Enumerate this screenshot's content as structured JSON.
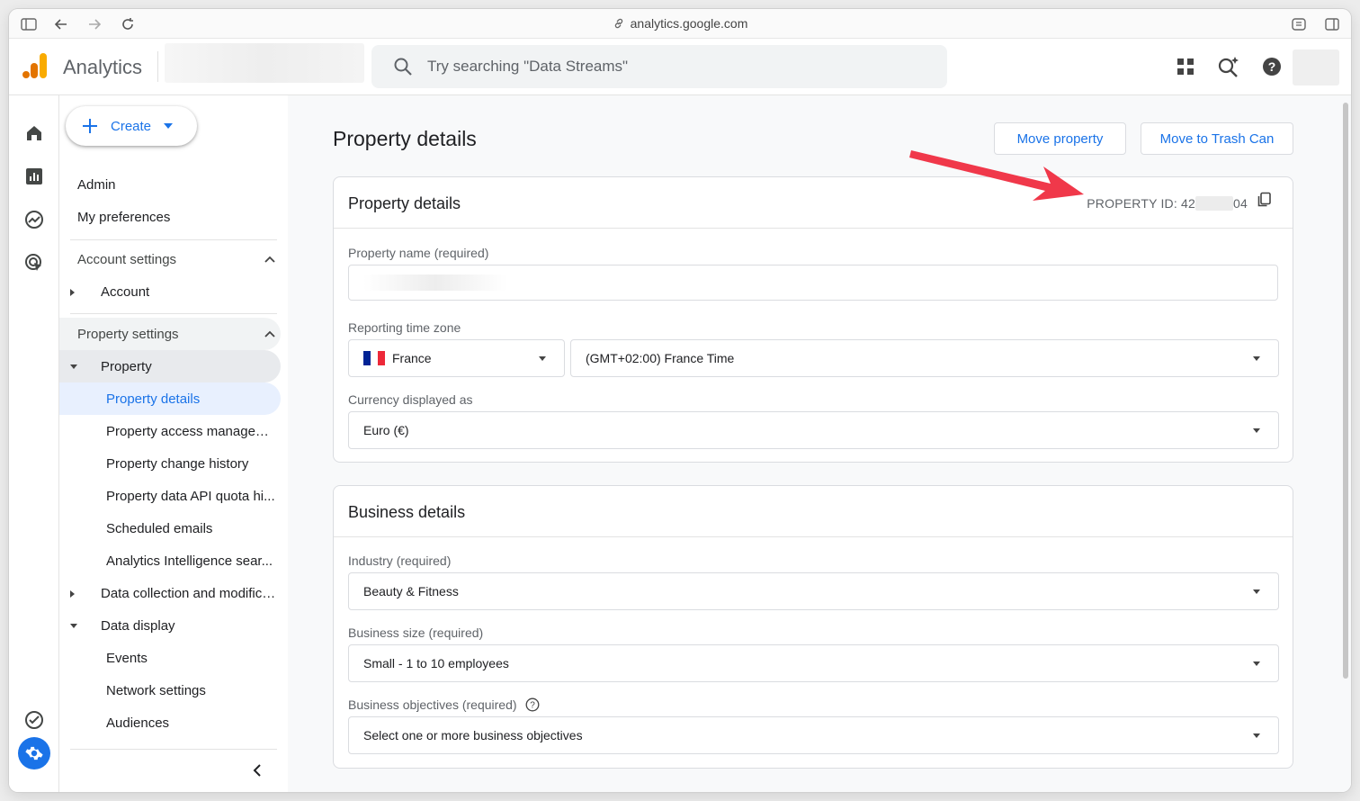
{
  "browser": {
    "url": "analytics.google.com"
  },
  "header": {
    "app_title": "Analytics",
    "search_placeholder": "Try searching \"Data Streams\""
  },
  "sidebar": {
    "create_label": "Create",
    "admin": "Admin",
    "my_preferences": "My preferences",
    "account_settings": "Account settings",
    "account": "Account",
    "property_settings": "Property settings",
    "property": "Property",
    "property_items": [
      "Property details",
      "Property access managem...",
      "Property change history",
      "Property data API quota hi...",
      "Scheduled emails",
      "Analytics Intelligence sear..."
    ],
    "data_collection": "Data collection and modifica...",
    "data_display": "Data display",
    "data_display_items": [
      "Events",
      "Network settings",
      "Audiences"
    ]
  },
  "main": {
    "page_title": "Property details",
    "move_property": "Move property",
    "move_to_trash": "Move to Trash Can",
    "property_card": {
      "title": "Property details",
      "property_id_prefix": "PROPERTY ID: 42",
      "property_id_suffix": "04",
      "property_name_label": "Property name (required)",
      "time_zone_label": "Reporting time zone",
      "country": "France",
      "time_zone": "(GMT+02:00) France Time",
      "currency_label": "Currency displayed as",
      "currency": "Euro (€)"
    },
    "business_card": {
      "title": "Business details",
      "industry_label": "Industry (required)",
      "industry": "Beauty & Fitness",
      "size_label": "Business size (required)",
      "size": "Small - 1 to 10 employees",
      "objectives_label": "Business objectives (required)",
      "objectives_placeholder": "Select one or more business objectives"
    }
  },
  "colors": {
    "accent": "#1a73e8",
    "arrow": "#f0384a",
    "logo_orange": "#f9ab00",
    "logo_dark": "#e37400"
  }
}
